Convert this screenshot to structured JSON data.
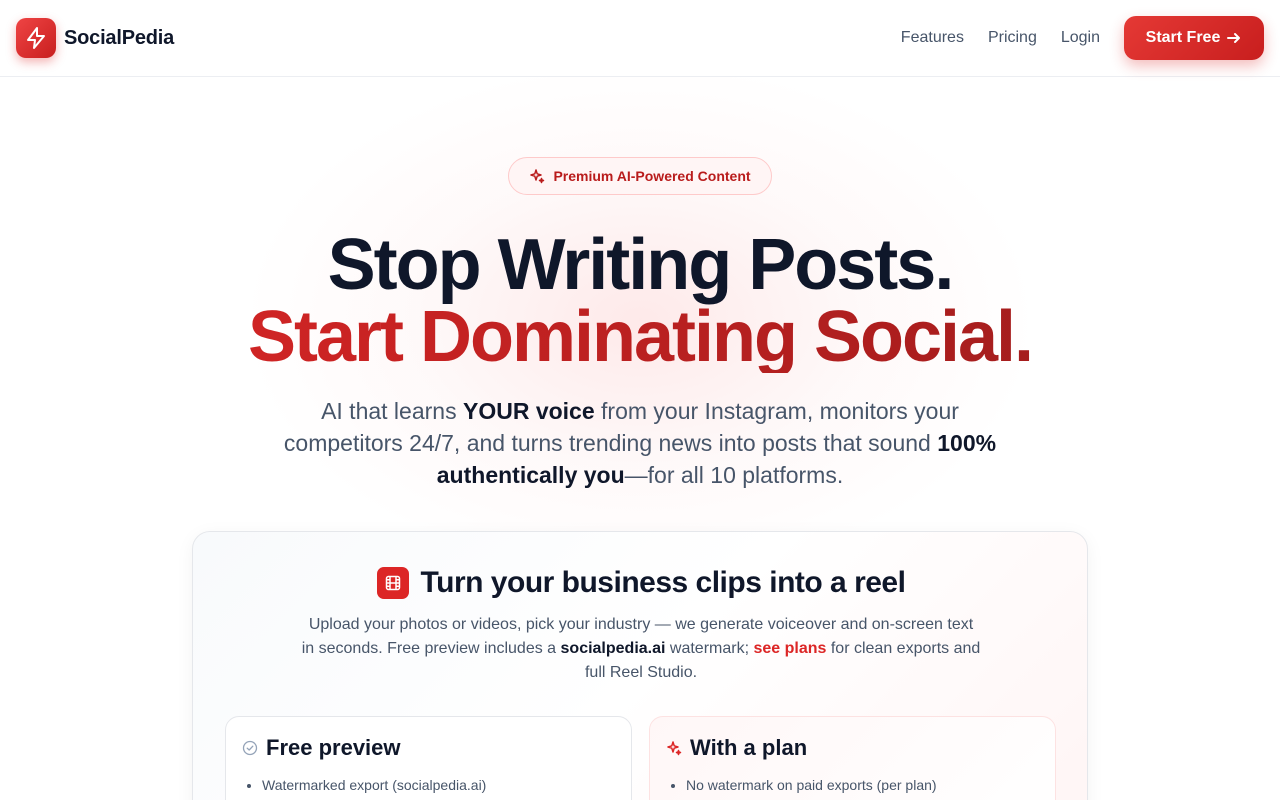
{
  "header": {
    "brand": "SocialPedia",
    "nav": [
      "Features",
      "Pricing",
      "Login"
    ],
    "cta_label": "Start Free"
  },
  "hero": {
    "badge": "Premium AI-Powered Content",
    "title_line1": "Stop Writing Posts.",
    "title_line2": "Start Dominating Social.",
    "sub_part1": "AI that learns ",
    "sub_bold1": "YOUR voice",
    "sub_part2": " from your Instagram, monitors your competitors 24/7, and turns trending news into posts that sound ",
    "sub_bold2": "100% authentically you",
    "sub_part3": "—for all 10 platforms."
  },
  "reel": {
    "title": "Turn your business clips into a reel",
    "desc_part1": "Upload your photos or videos, pick your industry — we generate voiceover and on-screen text in seconds. Free preview includes a ",
    "desc_bold": "socialpedia.ai",
    "desc_part2": " watermark; ",
    "desc_link": "see plans",
    "desc_part3": " for clean exports and full Reel Studio.",
    "free": {
      "title": "Free preview",
      "items": [
        "Watermarked export (socialpedia.ai)"
      ]
    },
    "plan": {
      "title": "With a plan",
      "items": [
        "No watermark on paid exports (per plan)"
      ]
    }
  },
  "colors": {
    "accent": "#dc2626",
    "accent_dark": "#991b1b",
    "text": "#0f172a",
    "muted": "#475569"
  },
  "icons": {
    "logo": "lightning-bolt-icon",
    "cta": "arrow-right-icon",
    "badge": "sparkles-icon",
    "reel": "film-icon",
    "free": "check-circle-icon",
    "plan": "sparkles-icon"
  }
}
